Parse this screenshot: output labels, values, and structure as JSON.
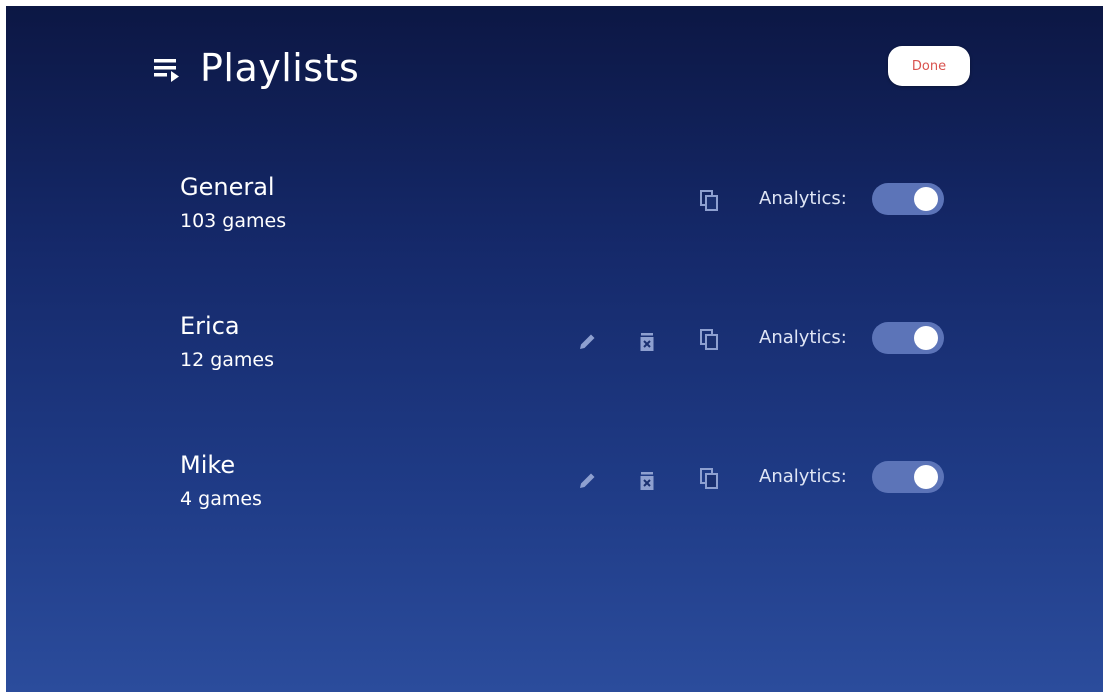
{
  "header": {
    "title": "Playlists",
    "icon": "playlist-icon",
    "done_label": "Done"
  },
  "playlists": [
    {
      "name": "General",
      "count": "103 games",
      "actions": [
        "copy"
      ],
      "analytics_label": "Analytics:",
      "analytics_on": true
    },
    {
      "name": "Erica",
      "count": "12 games",
      "actions": [
        "edit",
        "delete",
        "copy"
      ],
      "analytics_label": "Analytics:",
      "analytics_on": true
    },
    {
      "name": "Mike",
      "count": "4 games",
      "actions": [
        "edit",
        "delete",
        "copy"
      ],
      "analytics_label": "Analytics:",
      "analytics_on": true
    }
  ],
  "colors": {
    "background_top": "#0c1744",
    "background_bottom": "#2b4c9c",
    "toggle_track": "#5c74b8",
    "done_text": "#d9534f"
  }
}
